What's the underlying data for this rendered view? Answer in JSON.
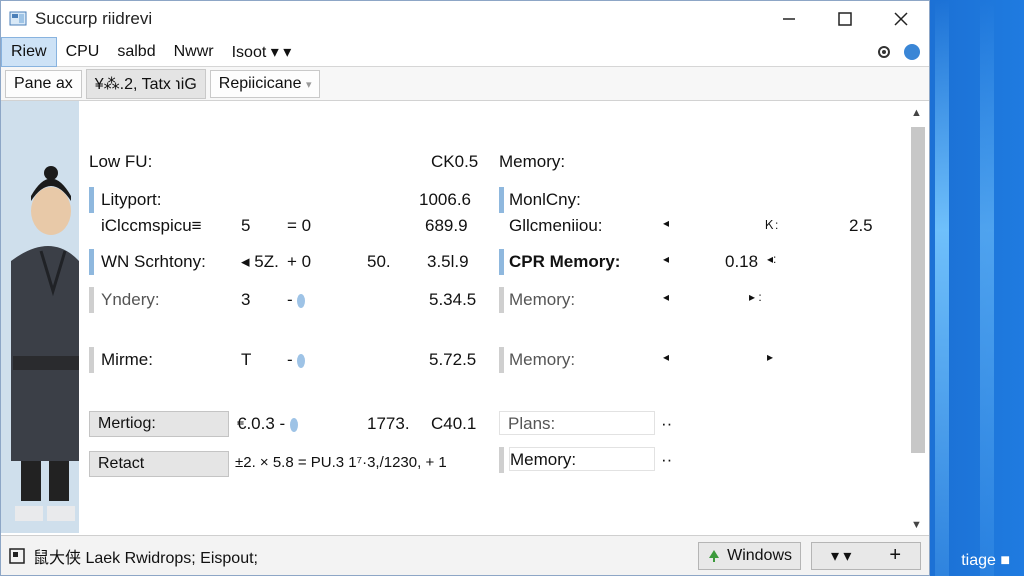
{
  "window": {
    "title": "Succurp riidrevi"
  },
  "menu": {
    "items": [
      "Riew",
      "CPU",
      "salbd",
      "Nwwr",
      "Isoot ▾ ▾"
    ]
  },
  "tabs": [
    "Pane ax",
    "¥⁂.2, Tatx ℩iG",
    "Repiicicane"
  ],
  "left_rows": [
    {
      "label": "Low FU:",
      "value": "CK0.5"
    },
    {
      "label": "Lityport:",
      "value": "1006.6"
    },
    {
      "label": "iClccmspicu≡",
      "num": "5",
      "op": "= 0",
      "value": "689.9"
    },
    {
      "label": "WN  Scrhtony:",
      "num": "◂ 5Z.",
      "op": "+ 0",
      "mid": "50.",
      "value": "3.5l.9"
    },
    {
      "label": "Yndery:",
      "num": "3",
      "op": "-",
      "value": "5.34.5"
    },
    {
      "label": "Mirme:",
      "num": "T",
      "op": "-",
      "value": "5.72.5"
    },
    {
      "label": "Mertiog:",
      "num": "€.0.3 -",
      "mid": "1773.",
      "value": "C40.1"
    },
    {
      "label": "Retact",
      "num": "±2. × 5.8 = PU.3 1⁷·3,/1230,  + 1"
    }
  ],
  "right_rows": [
    {
      "label": "Memory:"
    },
    {
      "label": "MonlCny:"
    },
    {
      "label": "Gllcmeniiou:",
      "ctrl": "◂",
      "ctrl2": "Ｋ:",
      "value": "2.5"
    },
    {
      "label": "CPR Memory:",
      "ctrl": "◂",
      "value": "0.18",
      "ctrl2": "◂:"
    },
    {
      "label": "Memory:",
      "ctrl": "◂",
      "ctrl2": "▸ :"
    },
    {
      "label": "Memory:",
      "ctrl": "◂",
      "ctrl2": "▸"
    },
    {
      "label": "Plans:",
      "ctrl": "··"
    },
    {
      "label": "Memory:",
      "ctrl": "··"
    }
  ],
  "status": {
    "left": "鼠大侠  Lаеk  Rwidrops;  Eispout;",
    "windows_button": "Windows",
    "stepper_minus": "▾  ▾",
    "stepper_plus": "+"
  },
  "desktop": {
    "right_text": "tiage ■"
  },
  "colors": {
    "accent": "#8fb8de",
    "menu_active": "#cde2f6"
  }
}
